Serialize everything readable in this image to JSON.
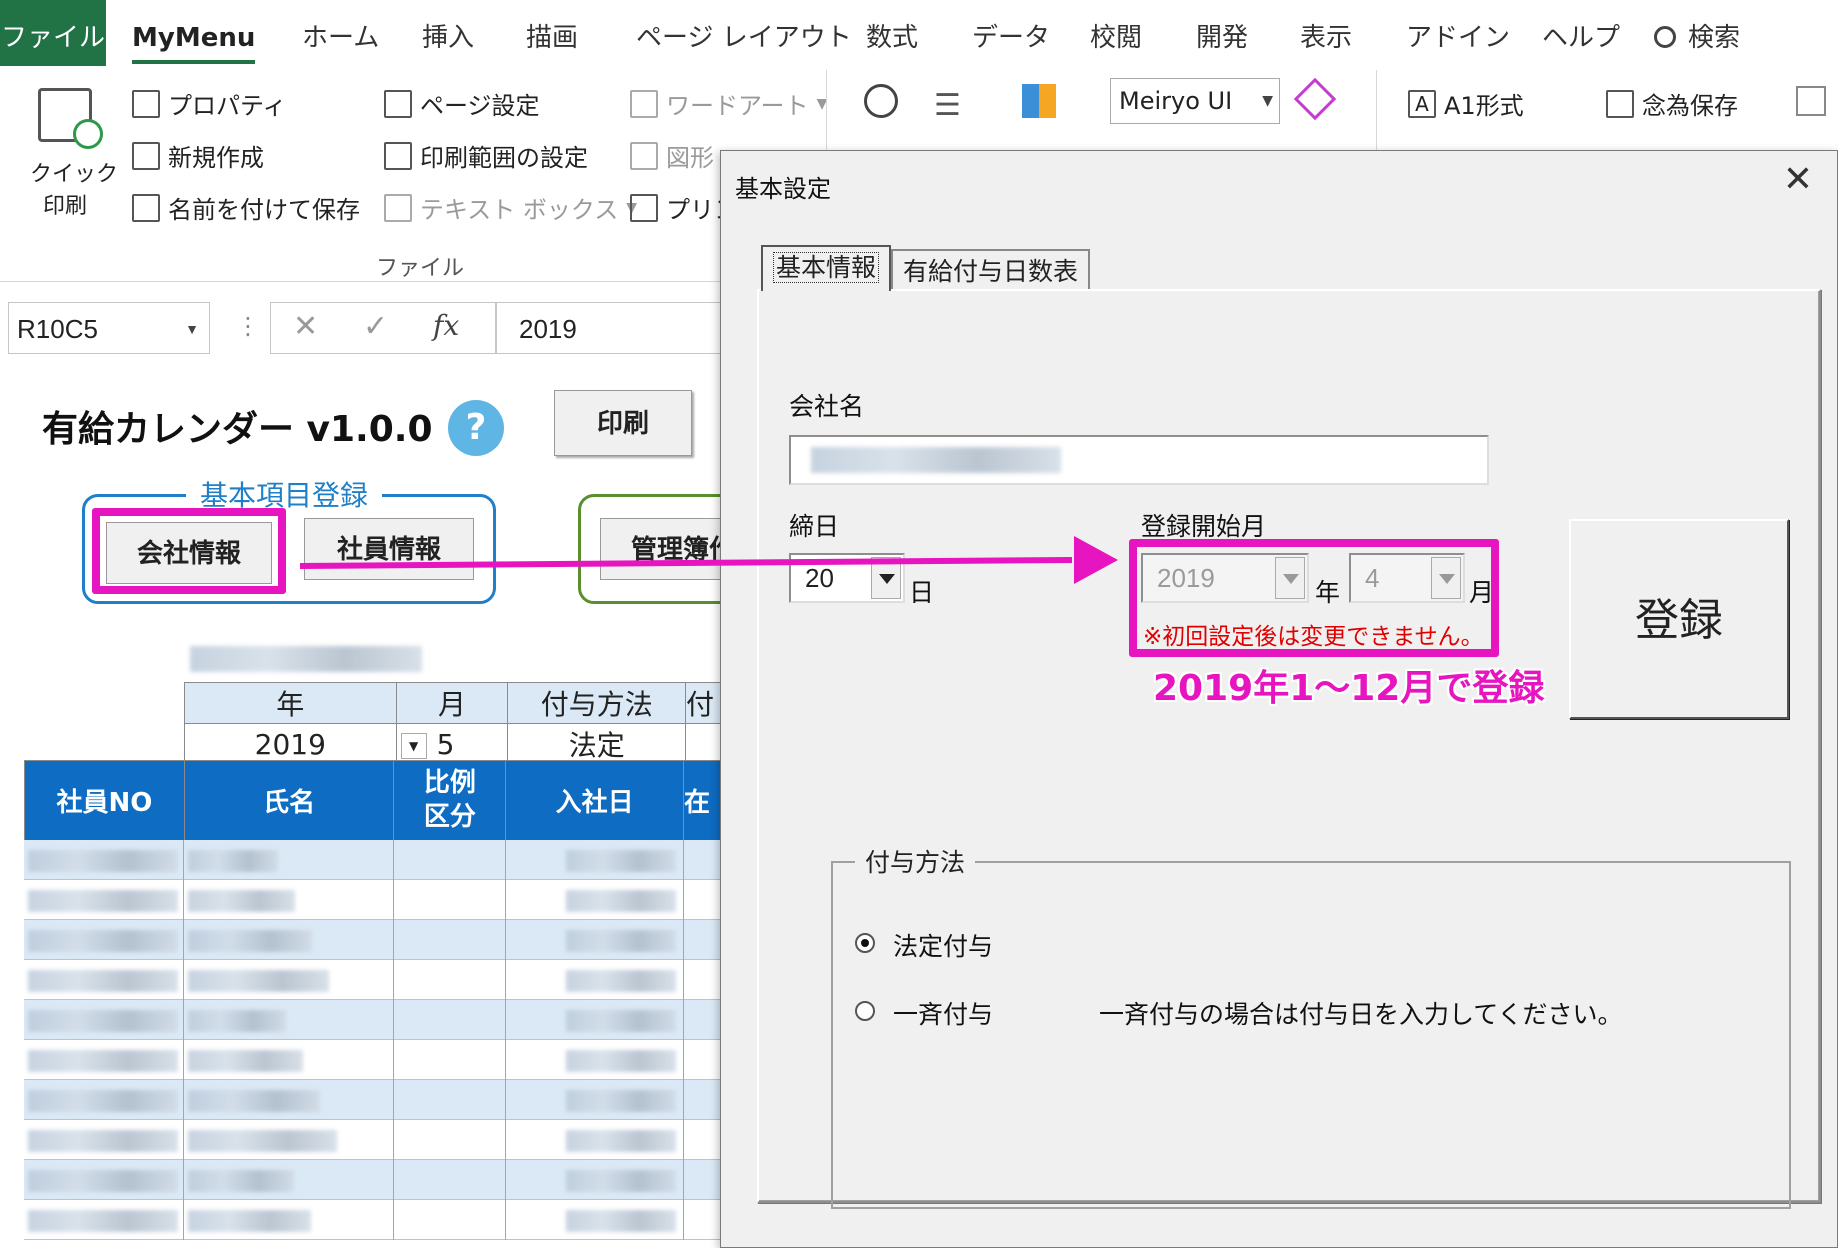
{
  "ribbon_tabs": [
    "ファイル",
    "MyMenu",
    "ホーム",
    "挿入",
    "描画",
    "ページ レイアウト",
    "数式",
    "データ",
    "校閲",
    "開発",
    "表示",
    "アドイン",
    "ヘルプ",
    "検索"
  ],
  "ribbon": {
    "quick_print_line1": "クイック",
    "quick_print_line2": "印刷",
    "properties": "プロパティ",
    "new": "新規作成",
    "save_as": "名前を付けて保存",
    "page_setup": "ページ設定",
    "print_area": "印刷範囲の設定",
    "text_box": "テキスト ボックス",
    "word_art": "ワードアート",
    "shapes": "図形",
    "printer": "プリン",
    "group_file": "ファイル",
    "font_name": "Meiryo UI",
    "a1_format": "A1形式",
    "backup_save": "念為保存"
  },
  "formula_bar": {
    "name_box": "R10C5",
    "value": "2019"
  },
  "sheet": {
    "title": "有給カレンダー v1.0.0",
    "help": "?",
    "print_button": "印刷",
    "group_label": "基本項目登録",
    "company_button": "会社情報",
    "employee_button": "社員情報",
    "ledger_button": "管理簿作",
    "param_headers": [
      "年",
      "月",
      "付与方法",
      "付"
    ],
    "param_values": [
      "2019",
      "5",
      "法定"
    ],
    "table_headers": [
      "社員NO",
      "氏名",
      "比例",
      "区分",
      "入社日",
      "在"
    ]
  },
  "dialog": {
    "title": "基本設定",
    "tabs": [
      "基本情報",
      "有給付与日数表"
    ],
    "company_label": "会社名",
    "closing_label": "締日",
    "closing_value": "20",
    "day_suffix": "日",
    "start_label": "登録開始月",
    "start_year": "2019",
    "year_suffix": "年",
    "start_month": "4",
    "month_suffix": "月",
    "warning": "※初回設定後は変更できません。",
    "register_button": "登録",
    "grant_method_label": "付与方法",
    "radio_statutory": "法定付与",
    "radio_uniform": "一斉付与",
    "uniform_note": "一斉付与の場合は付与日を入力してください。"
  },
  "annotation": "2019年1～12月で登録",
  "colors": {
    "excel_green": "#217346",
    "highlight": "#e615c0",
    "header_blue": "#0e6cc2",
    "warning_red": "#e00000"
  }
}
